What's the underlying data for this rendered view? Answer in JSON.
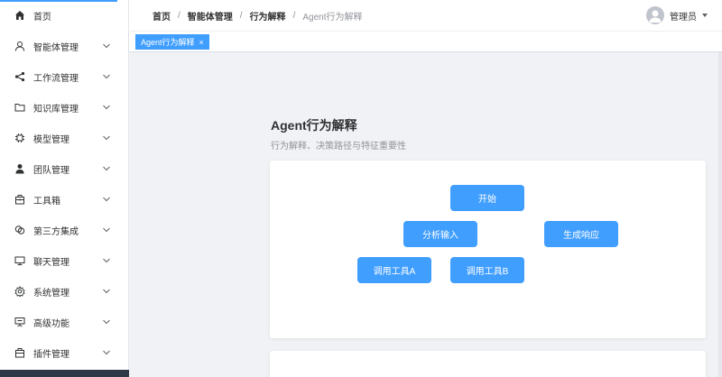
{
  "sidebar": {
    "items": [
      {
        "label": "首页",
        "icon": "home-icon",
        "has_arrow": false
      },
      {
        "label": "智能体管理",
        "icon": "user-icon",
        "has_arrow": true
      },
      {
        "label": "工作流管理",
        "icon": "share-icon",
        "has_arrow": true
      },
      {
        "label": "知识库管理",
        "icon": "folder-icon",
        "has_arrow": true
      },
      {
        "label": "模型管理",
        "icon": "cpu-icon",
        "has_arrow": true
      },
      {
        "label": "团队管理",
        "icon": "team-icon",
        "has_arrow": true
      },
      {
        "label": "工具箱",
        "icon": "toolbox-icon",
        "has_arrow": true
      },
      {
        "label": "第三方集成",
        "icon": "link-icon",
        "has_arrow": true
      },
      {
        "label": "聊天管理",
        "icon": "monitor-icon",
        "has_arrow": true
      },
      {
        "label": "系统管理",
        "icon": "gear-icon",
        "has_arrow": true
      },
      {
        "label": "高级功能",
        "icon": "presentation-icon",
        "has_arrow": true
      },
      {
        "label": "插件管理",
        "icon": "plugin-icon",
        "has_arrow": true
      }
    ]
  },
  "header": {
    "breadcrumb": [
      "首页",
      "智能体管理",
      "行为解释",
      "Agent行为解释"
    ],
    "separator": "/",
    "user_name": "管理员"
  },
  "tags": {
    "active_label": "Agent行为解释",
    "close_glyph": "×"
  },
  "main": {
    "title": "Agent行为解释",
    "subtitle": "行为解释、决策路径与特征重要性",
    "flow_nodes": {
      "start": "开始",
      "analyze": "分析输入",
      "generate": "生成响应",
      "tool_a": "调用工具A",
      "tool_b": "调用工具B"
    }
  },
  "colors": {
    "accent": "#409eff",
    "sidebar_bottom": "#2f3846",
    "background": "#f0f2f5"
  }
}
